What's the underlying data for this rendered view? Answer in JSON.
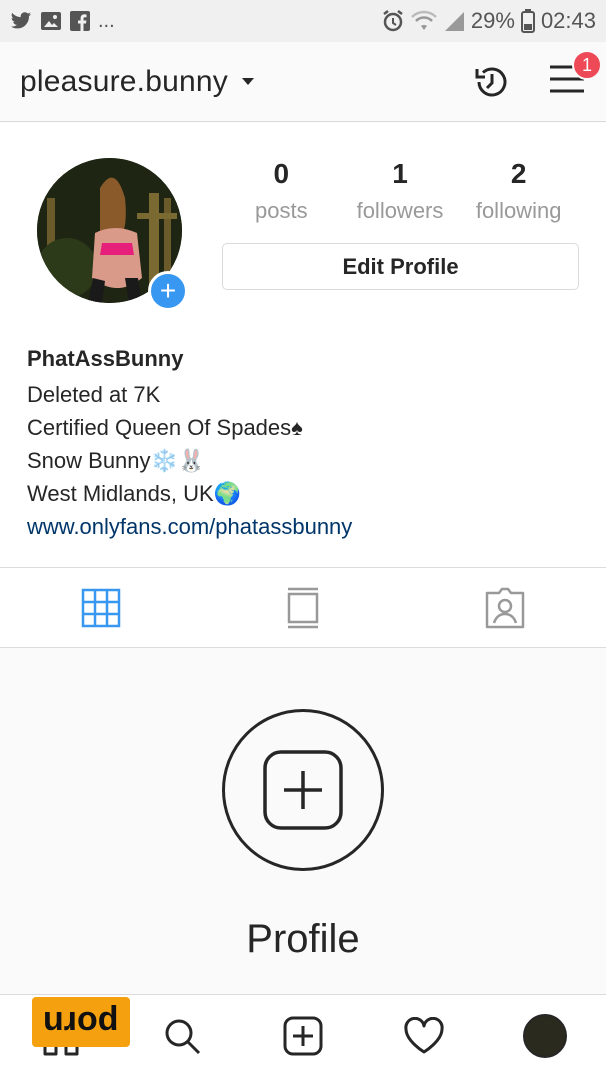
{
  "status_bar": {
    "left_icons": [
      "twitter-icon",
      "gallery-icon",
      "facebook-icon"
    ],
    "more": "...",
    "battery": "29%",
    "time": "02:43"
  },
  "header": {
    "username": "pleasure.bunny",
    "notification_count": "1"
  },
  "profile": {
    "stats": [
      {
        "value": "0",
        "label": "posts"
      },
      {
        "value": "1",
        "label": "followers"
      },
      {
        "value": "2",
        "label": "following"
      }
    ],
    "edit_button": "Edit Profile",
    "bio": {
      "name": "PhatAssBunny",
      "lines": [
        "Deleted at 7K",
        "Certified Queen Of Spades♠",
        "Snow Bunny❄️🐰",
        "West Midlands, UK🌍"
      ],
      "link": "www.onlyfans.com/phatassbunny"
    }
  },
  "tabs": [
    "grid-icon",
    "feed-icon",
    "tagged-icon"
  ],
  "empty_state": {
    "title": "Profile"
  },
  "bottom_nav": [
    "home-icon",
    "search-icon",
    "add-icon",
    "heart-icon",
    "profile-avatar"
  ],
  "watermark": "porn",
  "colors": {
    "accent": "#3897f0",
    "badge": "#ed4956",
    "link": "#003569",
    "watermark_bg": "#f5a10f"
  }
}
